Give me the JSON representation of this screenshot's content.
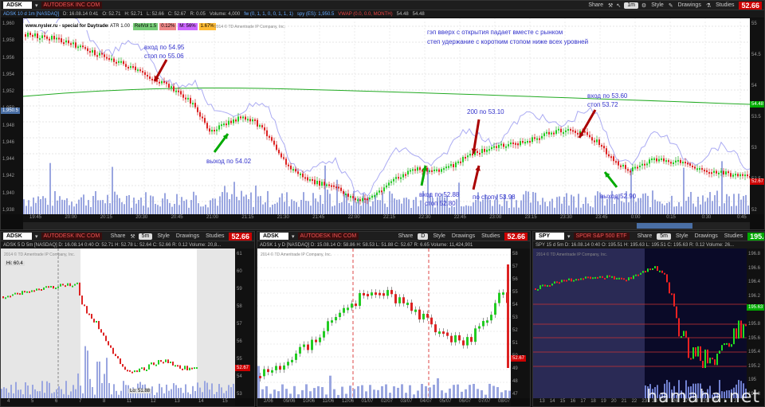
{
  "top": {
    "symbol": "ADSK",
    "company": "AUTODESK INC COM",
    "info": {
      "series": "ADSK 10 d 1m [NASDAQ]",
      "d": "D: 16.08.14 0:41",
      "o": "O: 52.71",
      "h": "H: 52.71",
      "l": "L: 52.66",
      "c": "C: 52.67",
      "r": "R: 0.05",
      "vol": "Volume: 4,000",
      "study1": "fw (0, 1, 1, 0, 0, 1, 1, 1)",
      "study2": "spy (ES): 1,950.5",
      "vwap": "VWAP (0.0, 0.0, MONTH)",
      "vwap_val1": "54.48",
      "vwap_val2": "54.48"
    },
    "toolbar": {
      "share": "Share",
      "period": "1m",
      "style": "Style",
      "drawings": "Drawings",
      "studies": "Studies"
    },
    "last_price": "52.66",
    "source_label": "www.nysler.ru - special for Daytrader",
    "badges": [
      {
        "text": "ATR 1.00",
        "color": "#fff"
      },
      {
        "text": "RelVol 1.5",
        "color": "#7c7"
      },
      {
        "text": "0.12%",
        "color": "#e88"
      },
      {
        "text": "M: 56%",
        "color": "#c6f"
      },
      {
        "text": "1.67%",
        "color": "#fb3"
      }
    ],
    "copyright": "2014 © TD Ameritrade IP Company, Inc.",
    "header_note_1": "гэп вверх с открытия падает вместе с рынком",
    "header_note_2": "степ удержание с коротким стопом ниже всех уровней",
    "annotations": [
      {
        "text": "вход по 54.95",
        "id": "entry-1"
      },
      {
        "text": "стоп по 55.06",
        "id": "stop-1"
      },
      {
        "text": "выход по 54.02",
        "id": "exit-1"
      },
      {
        "text": "200 по 53.10",
        "id": "size-2"
      },
      {
        "text": "вход по 52.88",
        "id": "entry-2"
      },
      {
        "text": "стоп 52.80",
        "id": "stop-2"
      },
      {
        "text": "по стопу 53.98",
        "id": "stopped-2"
      },
      {
        "text": "вход по 53.60",
        "id": "entry-3"
      },
      {
        "text": "стоп 53.72",
        "id": "stop-3"
      },
      {
        "text": "выход 52.90",
        "id": "exit-3"
      }
    ],
    "left_axis": [
      "1,960",
      "1,958",
      "1,956",
      "1,954",
      "1,952",
      "1,950",
      "1,948",
      "1,946",
      "1,944",
      "1,942",
      "1,940",
      "1,938"
    ],
    "left_axis_tag": "1,950.5",
    "right_axis": [
      "55",
      "54.5",
      "54",
      "53.5",
      "53",
      "52.5",
      "52"
    ],
    "right_tags": [
      {
        "text": "54.48",
        "color": "#0a0"
      },
      {
        "text": "52.67",
        "color": "#c00"
      }
    ],
    "time_axis": [
      "19:45",
      "20:00",
      "20:15",
      "20:30",
      "20:45",
      "21:00",
      "21:15",
      "21:30",
      "21:45",
      "22:00",
      "22:15",
      "22:30",
      "22:45",
      "23:00",
      "23:15",
      "23:30",
      "23:45",
      "0:00",
      "0:15",
      "0:30",
      "0:45"
    ]
  },
  "bl": {
    "symbol": "ADSK",
    "company": "AUTODESK INC COM",
    "toolbar": {
      "share": "Share",
      "period": "5m",
      "style": "Style",
      "drawings": "Drawings",
      "studies": "Studies"
    },
    "price": "52.66",
    "info": "ADSK 5 D 5m [NASDAQ]   D: 16.08.14 0:40   O: 52.71   H: 52.78   L: 52.64   C: 52.66   R: 0.12   Volume: 20,8...",
    "copyright": "2014 © TD Ameritrade IP Company, Inc.",
    "hi": "Hi: 60.4",
    "lo": "Lo: 51.88",
    "right_axis": [
      "61",
      "60",
      "59",
      "58",
      "57",
      "56",
      "55",
      "54",
      "53"
    ],
    "tag": "52.67",
    "time_axis": [
      "4",
      "5",
      "6",
      "7",
      "8",
      "11",
      "12",
      "13",
      "14",
      "15"
    ]
  },
  "bm": {
    "symbol": "ADSK",
    "company": "AUTODESK INC COM",
    "toolbar": {
      "share": "Share",
      "period": "D",
      "style": "Style",
      "drawings": "Drawings",
      "studies": "Studies"
    },
    "price": "52.66",
    "info": "ADSK 1 y D [NASDAQ]   D: 15.08.14   O: 58.86   H: 58.53   L: 51.88   C: 52.67   R: 6.65   Volume: 11,424,901",
    "copyright": "2014 © TD Ameritrade IP Company, Inc.",
    "right_axis": [
      "58",
      "57",
      "56",
      "55",
      "54",
      "53",
      "52",
      "51",
      "50",
      "49",
      "48",
      "47"
    ],
    "tag": "52.67",
    "vlines": [
      "2013.10.14",
      "2014.01.14"
    ],
    "time_axis": [
      "2/06",
      "09/06",
      "10/06",
      "11/06",
      "12/06",
      "01/07",
      "02/07",
      "03/07",
      "04/07",
      "05/07",
      "06/07",
      "07/07",
      "08/07"
    ]
  },
  "br": {
    "symbol": "SPY",
    "company": "SPDR S&P 500 ETF",
    "toolbar": {
      "share": "Share",
      "period": "5m",
      "style": "Style",
      "drawings": "Drawings",
      "studies": "Studies"
    },
    "price": "195.45",
    "info": "SPY 15 d 5m   D: 16.08.14 0:40   O: 195.51   H: 195.63   L: 195.51   C: 195.63   R: 0.12   Volume: 26...",
    "copyright": "2014 © TD Ameritrade IP Company, Inc.",
    "right_axis": [
      "196.8",
      "196.6",
      "196.4",
      "196.2",
      "196",
      "195.8",
      "195.6",
      "195.4",
      "195.2",
      "195",
      "194.8"
    ],
    "tag": "195.63",
    "time_axis": [
      "13",
      "14",
      "15",
      "16",
      "17",
      "18",
      "19",
      "20",
      "21",
      "22",
      "23",
      "24",
      "25",
      "26",
      "27",
      "28",
      "29",
      "30",
      "1",
      "2"
    ]
  },
  "watermark": "hamaha.net"
}
